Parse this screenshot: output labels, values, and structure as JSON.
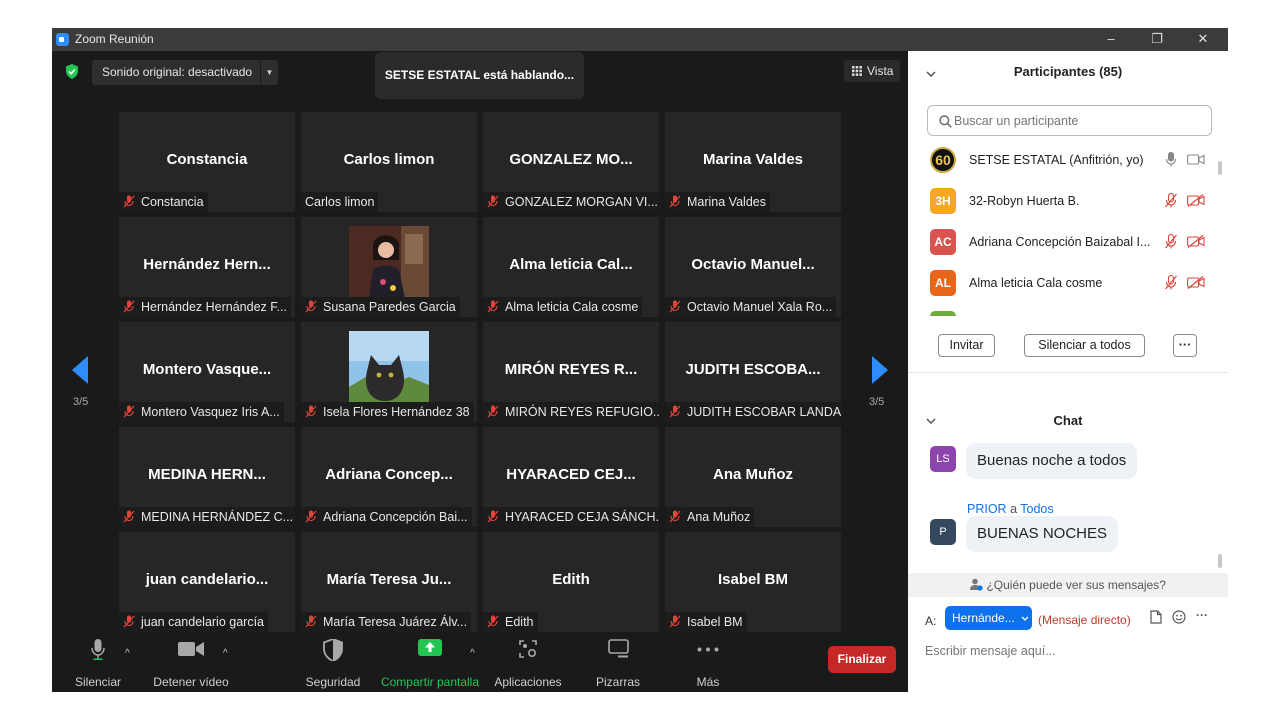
{
  "window": {
    "title": "Zoom Reunión",
    "minimize_glyph": "–",
    "maximize_glyph": "❐",
    "close_glyph": "✕"
  },
  "meeting": {
    "sound_label": "Sonido original: desactivado",
    "speaking": "SETSE ESTATAL está hablando...",
    "view_label": "Vista",
    "page_left": "3/5",
    "page_right": "3/5"
  },
  "tiles": [
    {
      "big": "Constancia",
      "name": "Constancia",
      "muted": true
    },
    {
      "big": "Carlos limon",
      "name": "Carlos limon",
      "muted": false
    },
    {
      "big": "GONZALEZ  MO...",
      "name": "GONZALEZ MORGAN VI...",
      "muted": true
    },
    {
      "big": "Marina Valdes",
      "name": "Marina Valdes",
      "muted": true
    },
    {
      "big": "Hernández  Hern...",
      "name": "Hernández Hernández F...",
      "muted": true
    },
    {
      "big": "",
      "name": "Susana Paredes Garcia",
      "muted": true,
      "photo": "woman"
    },
    {
      "big": "Alma leticia Cal...",
      "name": "Alma leticia Cala cosme",
      "muted": true
    },
    {
      "big": "Octavio  Manuel...",
      "name": "Octavio Manuel Xala Ro...",
      "muted": true
    },
    {
      "big": "Montero  Vasque...",
      "name": "Montero Vasquez Iris A...",
      "muted": true
    },
    {
      "big": "",
      "name": "Isela Flores Hernández 38",
      "muted": true,
      "photo": "cat"
    },
    {
      "big": "MIRÓN  REYES  R...",
      "name": "MIRÓN REYES REFUGIO...",
      "muted": true
    },
    {
      "big": "JUDITH  ESCOBA...",
      "name": "JUDITH ESCOBAR LANDA",
      "muted": true
    },
    {
      "big": "MEDINA  HERN...",
      "name": "MEDINA HERNÁNDEZ C...",
      "muted": true
    },
    {
      "big": "Adriana  Concep...",
      "name": "Adriana Concepción Bai...",
      "muted": true
    },
    {
      "big": "HYARACED  CEJ...",
      "name": "HYARACED CEJA SÁNCH...",
      "muted": true
    },
    {
      "big": "Ana Muñoz",
      "name": "Ana Muñoz",
      "muted": true
    },
    {
      "big": "juan  candelario...",
      "name": "juan candelario garcía",
      "muted": true
    },
    {
      "big": "María Teresa Ju...",
      "name": "María Teresa Juárez Álv...",
      "muted": true
    },
    {
      "big": "Edith",
      "name": "Edith",
      "muted": true
    },
    {
      "big": "Isabel BM",
      "name": "Isabel BM",
      "muted": true
    }
  ],
  "toolbar": {
    "mute": "Silenciar",
    "video": "Detener vídeo",
    "security": "Seguridad",
    "share": "Compartir pantalla",
    "apps": "Aplicaciones",
    "whiteboards": "Pizarras",
    "more": "Más",
    "end": "Finalizar",
    "caret": "^"
  },
  "participants": {
    "title": "Participantes (85)",
    "search_placeholder": "Buscar un participante",
    "list": [
      {
        "initials": "60",
        "name": "SETSE ESTATAL (Anfitrión, yo)",
        "color": "#111111",
        "mic_muted": false,
        "video_off": false
      },
      {
        "initials": "3H",
        "name": "32-Robyn Huerta B.",
        "color": "#f5a623",
        "mic_muted": true,
        "video_off": true
      },
      {
        "initials": "AC",
        "name": "Adriana Concepción Baizabal I...",
        "color": "#d9534f",
        "mic_muted": true,
        "video_off": true
      },
      {
        "initials": "AL",
        "name": "Alma leticia Cala cosme",
        "color": "#e8661a",
        "mic_muted": true,
        "video_off": true
      }
    ],
    "invite": "Invitar",
    "mute_all": "Silenciar a todos",
    "more": "···"
  },
  "chat": {
    "title": "Chat",
    "messages": [
      {
        "initials": "LS",
        "color": "#8e44ad",
        "text": "Buenas noche a todos"
      },
      {
        "initials": "P",
        "color": "#34495e",
        "text": "BUENAS NOCHES"
      }
    ],
    "sender": "PRIOR",
    "sender_joiner": "a",
    "sender_target": "Todos",
    "who_can_see": "¿Quién puede ver sus mensajes?",
    "to_label": "A:",
    "recipient": "Hernánde...",
    "direct": "(Mensaje directo)",
    "input_placeholder": "Escribir mensaje aquí...",
    "more": "···"
  },
  "colors": {
    "accent_blue": "#0e72ed",
    "end_red": "#c62828",
    "share_green": "#23c552",
    "muted_red": "#e0453a"
  }
}
